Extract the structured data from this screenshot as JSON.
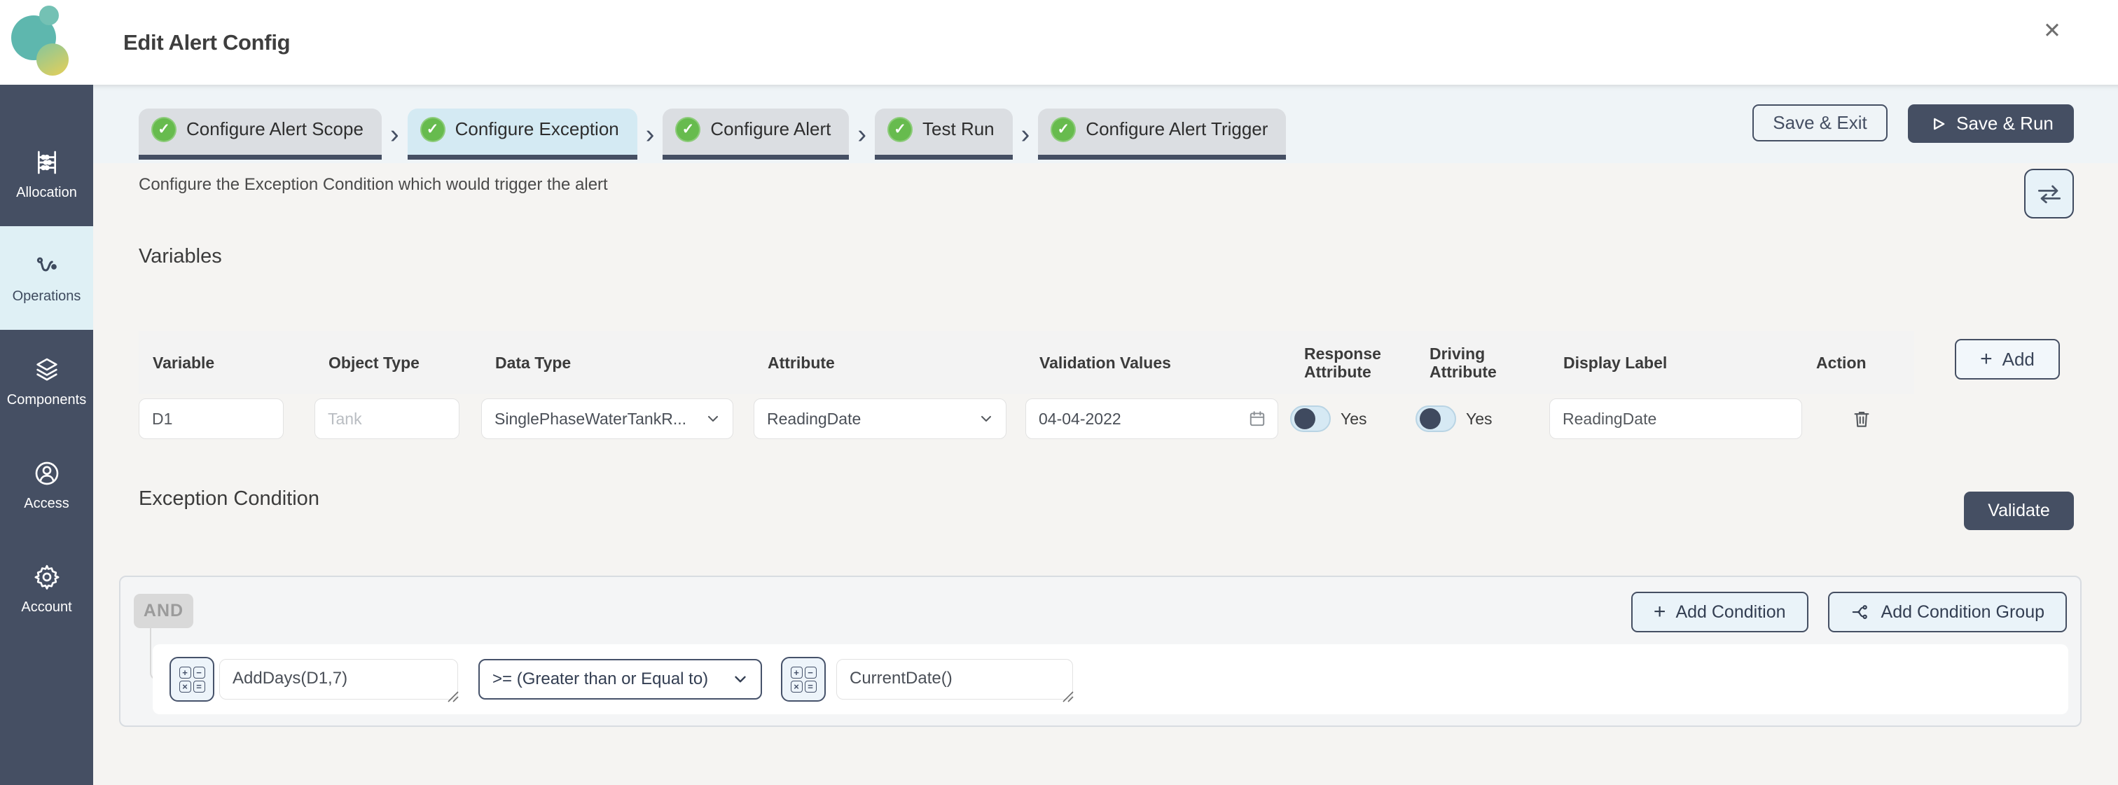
{
  "header": {
    "title": "Edit Alert Config"
  },
  "icons": {
    "close": "✕",
    "chevron_separator": "›",
    "plus": "+",
    "check": "✓",
    "calc": [
      "+",
      "−",
      "×",
      "="
    ]
  },
  "sidebar": {
    "items": [
      {
        "label": "Allocation",
        "icon": "abacus-icon",
        "active": false
      },
      {
        "label": "Operations",
        "icon": "flow-icon",
        "active": true
      },
      {
        "label": "Components",
        "icon": "layers-icon",
        "active": false
      },
      {
        "label": "Access",
        "icon": "user-circle-icon",
        "active": false
      },
      {
        "label": "Account",
        "icon": "gear-icon",
        "active": false
      }
    ]
  },
  "stepper": {
    "steps": [
      {
        "label": "Configure Alert Scope",
        "completed": true,
        "active": false
      },
      {
        "label": "Configure Exception",
        "completed": true,
        "active": true
      },
      {
        "label": "Configure Alert",
        "completed": true,
        "active": false
      },
      {
        "label": "Test Run",
        "completed": true,
        "active": false
      },
      {
        "label": "Configure Alert Trigger",
        "completed": true,
        "active": false
      }
    ]
  },
  "actions": {
    "save_exit": "Save & Exit",
    "save_run": "Save & Run"
  },
  "description": {
    "text": "Configure the Exception Condition which would trigger the alert"
  },
  "variables": {
    "heading": "Variables",
    "add_label": "Add",
    "columns": [
      "Variable",
      "Object Type",
      "Data Type",
      "Attribute",
      "Validation Values",
      "Response Attribute",
      "Driving Attribute",
      "Display Label",
      "Action"
    ],
    "row": {
      "variable": "D1",
      "object_type_placeholder": "Tank",
      "data_type": "SinglePhaseWaterTankR...",
      "attribute": "ReadingDate",
      "validation_value": "04-04-2022",
      "response_attribute": "Yes",
      "driving_attribute": "Yes",
      "display_label": "ReadingDate"
    }
  },
  "exception": {
    "heading": "Exception Condition",
    "validate_label": "Validate",
    "group_operator": "AND",
    "add_condition_label": "Add Condition",
    "add_condition_group_label": "Add Condition Group",
    "condition": {
      "lhs": "AddDays(D1,7)",
      "operator": ">= (Greater than or Equal to)",
      "rhs": "CurrentDate()"
    }
  },
  "colors": {
    "sidebar": "#454F63",
    "accent_navy": "#454F63",
    "active_tab_bg": "#D4EAF3",
    "active_sidebar_bg": "#DFF0F5",
    "step_done_green": "#67BB4E",
    "band_bg": "#EFF4F7",
    "page_bg": "#F5F4F2",
    "panel_bg": "#F4F5F6"
  }
}
